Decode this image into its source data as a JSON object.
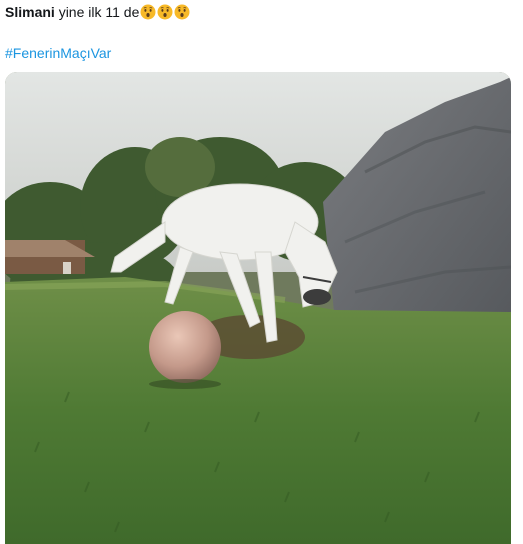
{
  "tweet": {
    "author": "Slimani",
    "text": "yine ilk 11 de",
    "emoji": [
      "hushed-face-icon",
      "hushed-face-icon",
      "hushed-face-icon"
    ],
    "hashtag": "#FenerinMaçıVar"
  },
  "media": {
    "type": "video-still",
    "icon": "video-media-icon"
  },
  "colors": {
    "link": "#1b95e0",
    "text": "#14171a",
    "emoji": "#f7b928"
  }
}
